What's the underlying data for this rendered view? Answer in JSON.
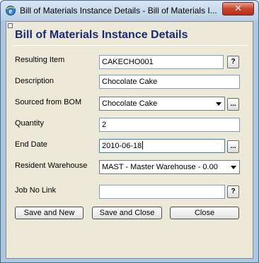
{
  "window": {
    "title": "Bill of Materials Instance Details - Bill of Materials I...",
    "close_label": "✕"
  },
  "form": {
    "heading": "Bill of Materials Instance Details",
    "fields": {
      "resulting_item": {
        "label": "Resulting Item",
        "value": "CAKECHO001",
        "button": "?"
      },
      "description": {
        "label": "Description",
        "value": "Chocolate Cake"
      },
      "sourced_from_bom": {
        "label": "Sourced from BOM",
        "value": "Chocolate Cake",
        "button": "..."
      },
      "quantity": {
        "label": "Quantity",
        "value": "2"
      },
      "end_date": {
        "label": "End Date",
        "value": "2010-06-18",
        "button": "..."
      },
      "resident_warehouse": {
        "label": "Resident Warehouse",
        "value": "MAST - Master Warehouse - 0.00"
      },
      "job_no_link": {
        "label": "Job No Link",
        "value": "",
        "button": "?"
      }
    },
    "buttons": {
      "save_and_new": "Save and New",
      "save_and_close": "Save and Close",
      "close": "Close"
    }
  },
  "colors": {
    "heading": "#1a2a78",
    "dialog_background": "#ece9d8",
    "frame": "#aec6e0"
  }
}
